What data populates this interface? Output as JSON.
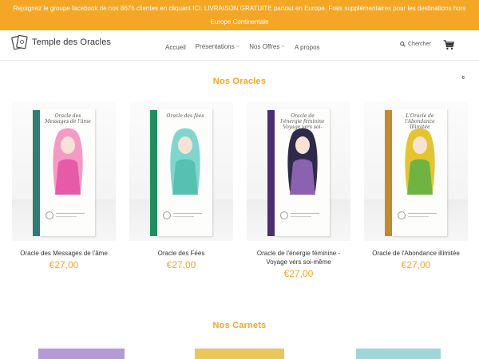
{
  "announcement": {
    "line1": "Rejoignez le groupe facebook de nos 8676 clientes en cliquant ICI. LIVRAISON GRATUITE partout en Europe. Frais supplémentaires pour les destinations hors",
    "line2": "Europe Continentale"
  },
  "header": {
    "logo_text": "Temple des Oracles",
    "nav": {
      "accueil": "Accueil",
      "presentations": "Présentations",
      "offres": "Nos Offres",
      "apropos": "A propos"
    },
    "search_label": "Chercher",
    "cart_count": "0"
  },
  "sections": {
    "oracles_title": "Nos Oracles",
    "carnets_title": "Nos Carnets"
  },
  "products": [
    {
      "name": "Oracle des Messages de l'âme",
      "price": "€27,00",
      "cover_title": "Oracle des Messages de l'âme",
      "spine_color": "#2f7d74",
      "art_color": "#e75aa8",
      "art_hair": "#f59ac4"
    },
    {
      "name": "Oracle des Fées",
      "price": "€27,00",
      "cover_title": "Oracle des fées",
      "spine_color": "#1f8f5e",
      "art_color": "#58bfb3",
      "art_hair": "#7fd6cf"
    },
    {
      "name": "Oracle de l'énergie féminine - Voyage vers soi-même",
      "price": "€27,00",
      "cover_title": "Oracle de l'énergie féminine Voyage vers soi-même",
      "spine_color": "#4a2f6f",
      "art_color": "#8a62b0",
      "art_hair": "#2e2a4a"
    },
    {
      "name": "Oracle de l'Abondance illimitée",
      "price": "€27,00",
      "cover_title": "L'Oracle de l'Abondance Illimitée",
      "spine_color": "#c48a2b",
      "art_color": "#6fb342",
      "art_hair": "#e6c42e"
    }
  ],
  "carnets": [
    {
      "color": "#b59ad6"
    },
    {
      "color": "#ebc65a"
    },
    {
      "color": "#9fd7d8"
    }
  ]
}
